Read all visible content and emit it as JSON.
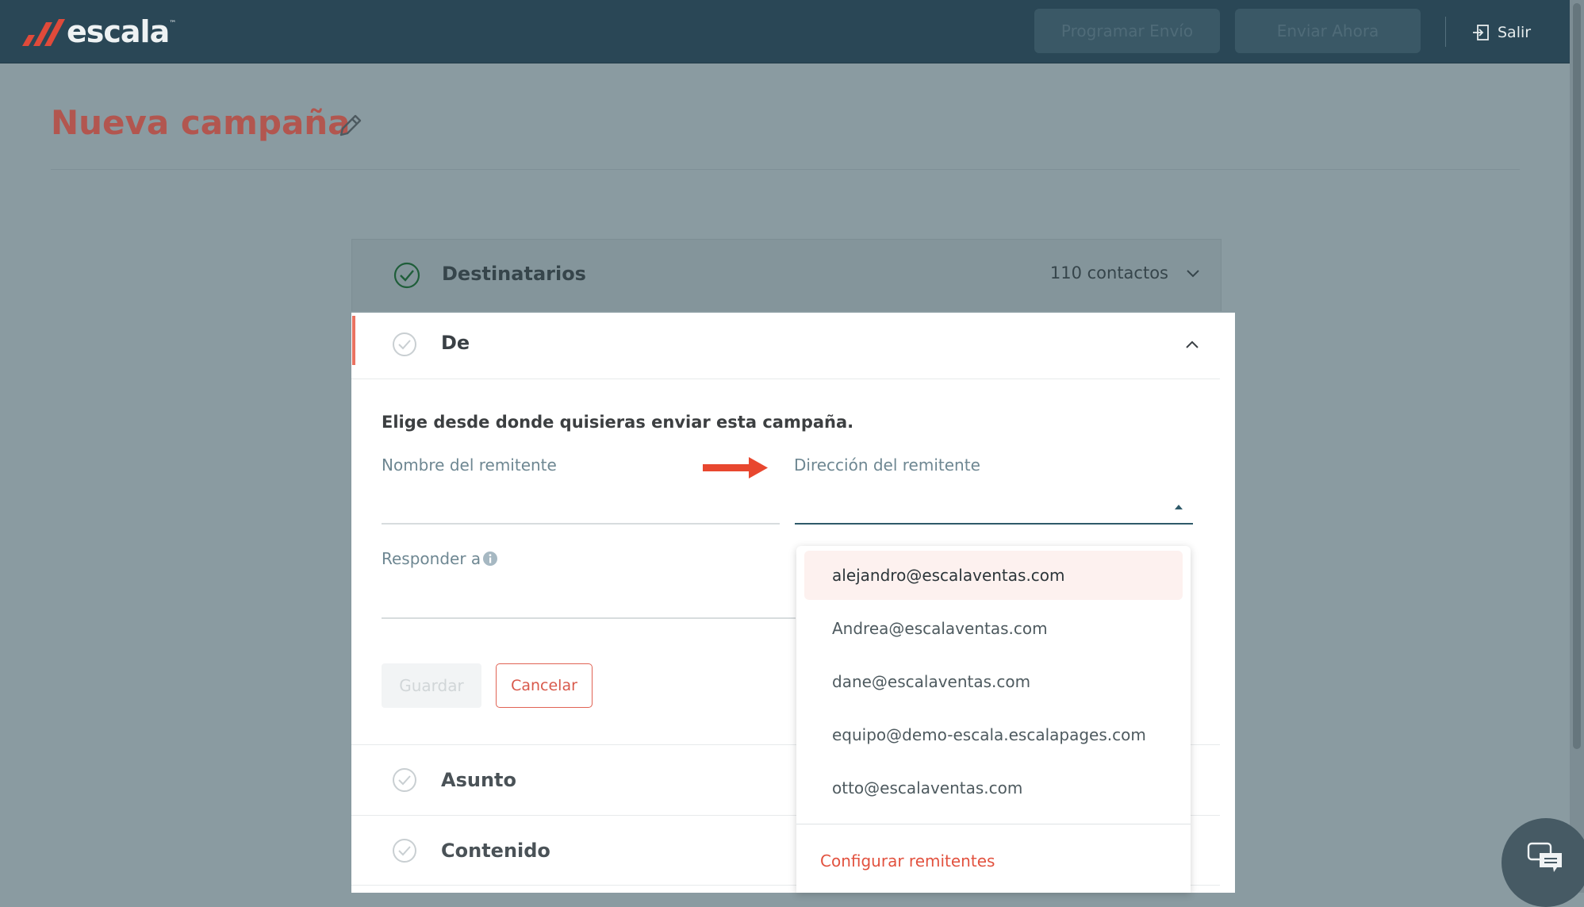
{
  "header": {
    "logo_text": "escala",
    "logo_tm": "™",
    "program_button": "Programar Envío",
    "send_button": "Enviar Ahora",
    "logout_label": "Salir"
  },
  "page": {
    "title": "Nueva campaña"
  },
  "sections": {
    "recipients": {
      "label": "Destinatarios",
      "count": "110 contactos"
    },
    "from": {
      "label": "De",
      "instruction": "Elige desde donde quisieras enviar esta campaña.",
      "sender_name_label": "Nombre del remitente",
      "sender_address_label": "Dirección del remitente",
      "reply_to_label": "Responder a",
      "save_button": "Guardar",
      "cancel_button": "Cancelar"
    },
    "subject": {
      "label": "Asunto"
    },
    "content": {
      "label": "Contenido"
    }
  },
  "dropdown": {
    "options": [
      "alejandro@escalaventas.com",
      "Andrea@escalaventas.com",
      "dane@escalaventas.com",
      "equipo@demo-escala.escalapages.com",
      "otto@escalaventas.com"
    ],
    "configure_link": "Configurar remitentes"
  },
  "colors": {
    "topbar": "#2a4756",
    "accent_red": "#e2523f",
    "title_red": "#b2564f",
    "overlay": "#8a9ba1"
  }
}
